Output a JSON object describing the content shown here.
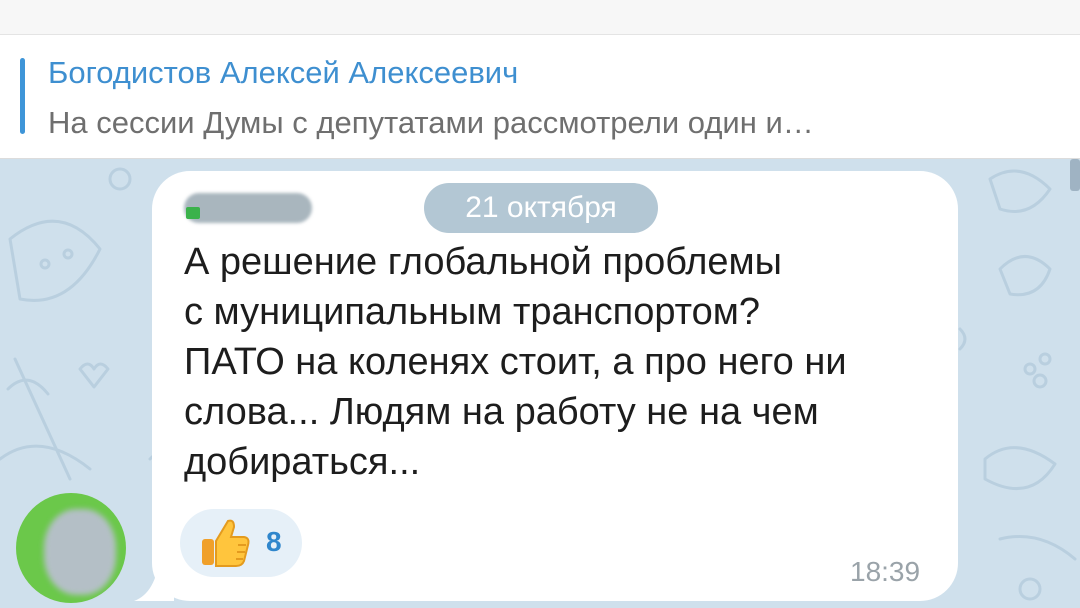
{
  "pinned_message": {
    "title": "Богодистов Алексей Алексеевич",
    "preview": "На сессии Думы с депутатами рассмотрели один и…"
  },
  "message": {
    "date_separator": "21 октября",
    "lines": [
      "А решение глобальной проблемы",
      "с муниципальным транспортом?",
      "ПАТО на коленях стоит, а про него ни",
      "слова... Людям на работу не на чем",
      "добираться..."
    ],
    "reaction": {
      "icon": "thumbs-up-icon",
      "count": "8"
    },
    "time": "18:39"
  },
  "colors": {
    "accent": "#3e8fd0",
    "chat_background": "#cfe0ec",
    "bubble": "#ffffff",
    "avatar_ring": "#6bc84a",
    "reaction_count": "#2f86cc"
  }
}
